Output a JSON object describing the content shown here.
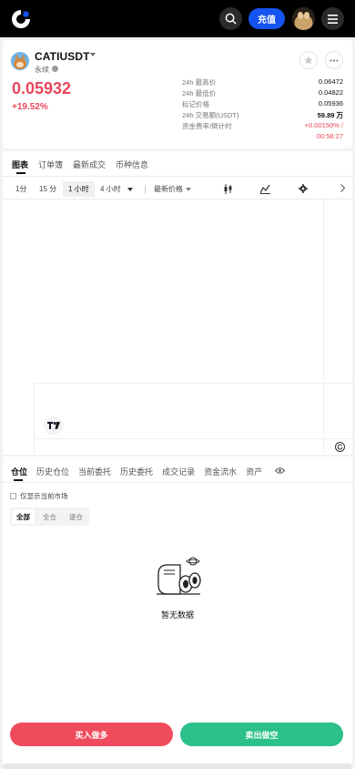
{
  "topbar": {
    "deposit_label": "充值",
    "logo_icon": "exchange-logo-icon",
    "search_icon": "search-icon",
    "menu_icon": "hamburger-icon"
  },
  "header": {
    "symbol": "CATIUSDT",
    "contract_type": "永续",
    "price": "0.05932",
    "change": "+19.52%",
    "stats": [
      {
        "label": "24h 最高价",
        "value": "0.06472"
      },
      {
        "label": "24h 最低价",
        "value": "0.04822"
      },
      {
        "label": "标记价格",
        "value": "0.05936"
      },
      {
        "label": "24h 交易额(USDT)",
        "value": "59.89 万"
      },
      {
        "label": "资金费率/倒计时",
        "value": "+0.00150% /"
      }
    ],
    "countdown": "00:58:27",
    "colors": {
      "down_red": "#e8475b",
      "up_green": "#2cc08a",
      "brand_blue": "#1554f0"
    }
  },
  "chart_tabs": [
    "图表",
    "订单簿",
    "最新成交",
    "币种信息"
  ],
  "intervals": {
    "items": [
      "1分",
      "15 分",
      "1 小时",
      "4 小时"
    ],
    "selected": "1 小时",
    "price_type": "最新价格"
  },
  "bottom_tabs": [
    "仓位",
    "历史仓位",
    "当前委托",
    "历史委托",
    "成交记录",
    "资金流水",
    "资产"
  ],
  "filter": {
    "only_current_label": "仅显示当前市场",
    "segments": [
      "全部",
      "全仓",
      "逐仓"
    ],
    "selected_segment": "全部"
  },
  "empty_state": "暂无数据",
  "actions": {
    "buy_label": "买入做多",
    "sell_label": "卖出做空"
  }
}
